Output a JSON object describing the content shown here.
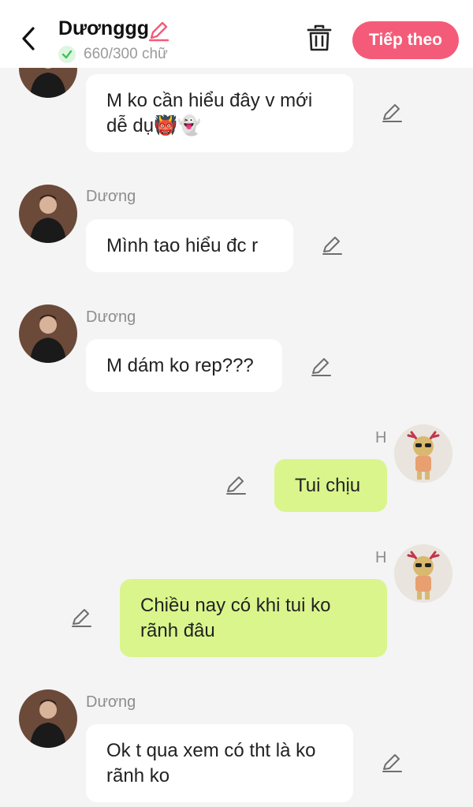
{
  "header": {
    "title": "Dươnggg",
    "count": "660/300 chữ",
    "next_label": "Tiếp theo"
  },
  "messages": [
    {
      "side": "left",
      "name": "",
      "text": "M ko cần hiểu đây v mới dễ dụ👹👻"
    },
    {
      "side": "left",
      "name": "Dương",
      "text": "Mình tao hiểu đc r"
    },
    {
      "side": "left",
      "name": "Dương",
      "text": "M dám ko rep???"
    },
    {
      "side": "right",
      "name": "H",
      "text": "Tui chịu"
    },
    {
      "side": "right",
      "name": "H",
      "text": "Chiều nay có khi tui ko rãnh đâu"
    },
    {
      "side": "left",
      "name": "Dương",
      "text": "Ok t qua xem có tht là ko rãnh ko"
    }
  ],
  "colors": {
    "accent": "#f45b78",
    "outgoing_bubble": "#d9f58c",
    "incoming_bubble": "#ffffff",
    "background": "#f4f4f4",
    "check": "#3ec45a"
  },
  "icons": [
    "back-arrow-icon",
    "pencil-icon",
    "check-circle-icon",
    "trash-icon",
    "edit-pencil-icon"
  ]
}
